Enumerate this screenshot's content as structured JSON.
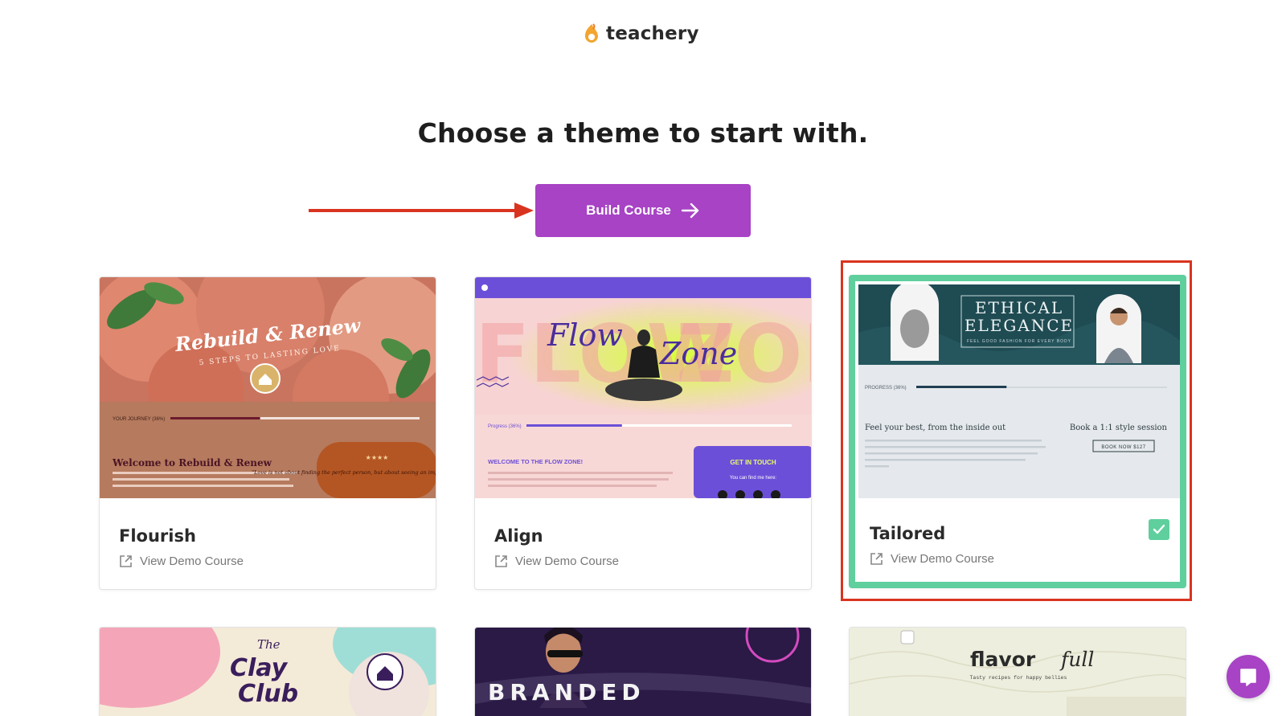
{
  "brand": {
    "name": "teachery",
    "accent": "#a743c4",
    "selected_color": "#5fcf9d",
    "annotation_color": "#d93420"
  },
  "header": {
    "title": "Choose a theme to start with."
  },
  "actions": {
    "build_label": "Build Course",
    "build_icon": "arrow-right-icon"
  },
  "themes": [
    {
      "name": "Flourish",
      "demo_label": "View Demo Course",
      "selected": false,
      "preview": {
        "title": "Rebuild & Renew",
        "subtitle": "5 STEPS TO LASTING LOVE",
        "progress_label": "YOUR JOURNEY (36%)",
        "progress": 0.36,
        "welcome": "Welcome to Rebuild & Renew",
        "quote": "\"Love is not about finding the perfect person, but about seeing an imperfect person perfectly.\""
      }
    },
    {
      "name": "Align",
      "demo_label": "View Demo Course",
      "selected": false,
      "preview": {
        "title_a": "Flow",
        "title_b": "Zone",
        "bg_word_a": "FLOW",
        "bg_word_b": "ZONE",
        "progress_label": "Progress (36%)",
        "progress": 0.36,
        "welcome": "WELCOME TO THE FLOW ZONE!",
        "cta": "GET IN TOUCH",
        "cta_sub": "You can find me here:"
      }
    },
    {
      "name": "Tailored",
      "demo_label": "View Demo Course",
      "selected": true,
      "preview": {
        "title_a": "ETHICAL",
        "title_b": "ELEGANCE",
        "tagline": "FEEL GOOD FASHION FOR EVERY BODY",
        "progress_label": "PROGRESS (36%)",
        "progress": 0.36,
        "heading": "Feel your best, from the inside out",
        "side_heading": "Book a 1:1 style session",
        "button": "BOOK NOW $127"
      }
    },
    {
      "name": "",
      "demo_label": "",
      "preview": {
        "title_a": "The",
        "title_b": "Clay",
        "title_c": "Club"
      }
    },
    {
      "name": "",
      "demo_label": "",
      "preview": {
        "title": "BRANDED"
      }
    },
    {
      "name": "",
      "demo_label": "",
      "preview": {
        "title_a": "flavor",
        "title_b": "full",
        "tagline": "Tasty recipes for happy bellies"
      }
    }
  ]
}
